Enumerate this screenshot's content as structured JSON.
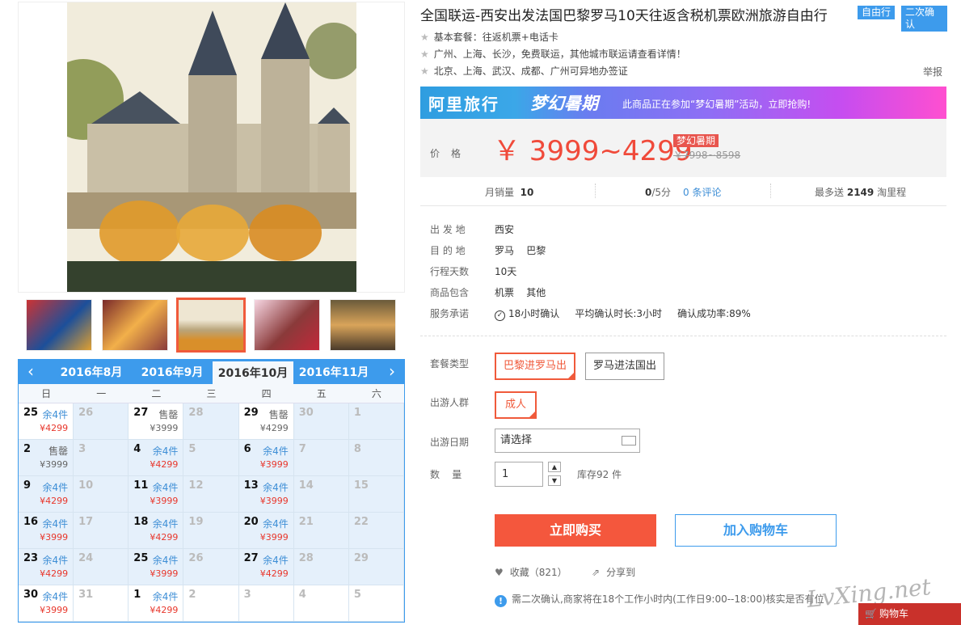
{
  "product": {
    "title": "全国联运-西安出发法国巴黎罗马10天往返含税机票欧洲旅游自由行",
    "tags": [
      "自由行",
      "二次确认"
    ],
    "features": [
      "基本套餐：往返机票+电话卡",
      "广州、上海、长沙，免费联运，其他城市联运请查看详情！",
      "北京、上海、武汉、成都、广州可异地办签证"
    ],
    "report": "举报"
  },
  "banner": {
    "brand": "阿里旅行",
    "campaign": "梦幻暑期",
    "message": "此商品正在参加“梦幻暑期”活动，立即抢购!"
  },
  "price": {
    "label": "价格",
    "value": "￥ 3999~4299",
    "badge": "梦幻暑期",
    "original": "￥7998~8598"
  },
  "stats": {
    "sales_label": "月销量",
    "sales": "10",
    "rating": "0",
    "rating_suffix": "/5分",
    "reviews": "0 条评论",
    "points_prefix": "最多送",
    "points": "2149",
    "points_suffix": "淘里程"
  },
  "details": [
    {
      "label": "出 发 地",
      "value": "西安"
    },
    {
      "label": "目 的 地",
      "value": "罗马    巴黎"
    },
    {
      "label": "行程天数",
      "value": "10天"
    },
    {
      "label": "商品包含",
      "value": "机票    其他"
    },
    {
      "label": "服务承诺",
      "value": "18小时确认     平均确认时长:3小时     确认成功率:89%"
    }
  ],
  "options": {
    "package_label": "套餐类型",
    "packages": [
      "巴黎进罗马出",
      "罗马进法国出"
    ],
    "group_label": "出游人群",
    "groups": [
      "成人"
    ],
    "date_label": "出游日期",
    "date_placeholder": "请选择",
    "qty_label": "数    量",
    "qty": "1",
    "stock": "库存92 件"
  },
  "actions": {
    "buy": "立即购买",
    "cart": "加入购物车",
    "favorite": "收藏（821）",
    "share": "分享到"
  },
  "note": "需二次确认,商家将在18个工作小时内(工作日9:00--18:00)核实是否有位",
  "watermark": "LvXing.net",
  "float_cart": "购物车",
  "calendar": {
    "months": [
      "2016年8月",
      "2016年9月",
      "2016年10月",
      "2016年11月"
    ],
    "active_month": "2016年10月",
    "weekdays": [
      "日",
      "一",
      "二",
      "三",
      "四",
      "五",
      "六"
    ],
    "cells": [
      {
        "d": "25",
        "s": "余4件",
        "p": "¥4299",
        "on": true
      },
      {
        "d": "26",
        "g": true
      },
      {
        "d": "27",
        "s": "售罄",
        "p": "¥3999",
        "on": true,
        "sold": true
      },
      {
        "d": "28",
        "g": true
      },
      {
        "d": "29",
        "s": "售罄",
        "p": "¥4299",
        "on": true,
        "sold": true
      },
      {
        "d": "30",
        "g": true
      },
      {
        "d": "1",
        "g": true
      },
      {
        "d": "2",
        "s": "售罄",
        "p": "¥3999",
        "sold": true
      },
      {
        "d": "3",
        "g": true
      },
      {
        "d": "4",
        "s": "余4件",
        "p": "¥4299"
      },
      {
        "d": "5",
        "g": true
      },
      {
        "d": "6",
        "s": "余4件",
        "p": "¥3999"
      },
      {
        "d": "7",
        "g": true
      },
      {
        "d": "8",
        "g": true
      },
      {
        "d": "9",
        "s": "余4件",
        "p": "¥4299"
      },
      {
        "d": "10",
        "g": true
      },
      {
        "d": "11",
        "s": "余4件",
        "p": "¥3999"
      },
      {
        "d": "12",
        "g": true
      },
      {
        "d": "13",
        "s": "余4件",
        "p": "¥3999"
      },
      {
        "d": "14",
        "g": true
      },
      {
        "d": "15",
        "g": true
      },
      {
        "d": "16",
        "s": "余4件",
        "p": "¥3999"
      },
      {
        "d": "17",
        "g": true
      },
      {
        "d": "18",
        "s": "余4件",
        "p": "¥4299"
      },
      {
        "d": "19",
        "g": true
      },
      {
        "d": "20",
        "s": "余4件",
        "p": "¥3999"
      },
      {
        "d": "21",
        "g": true
      },
      {
        "d": "22",
        "g": true
      },
      {
        "d": "23",
        "s": "余4件",
        "p": "¥4299"
      },
      {
        "d": "24",
        "g": true
      },
      {
        "d": "25",
        "s": "余4件",
        "p": "¥3999"
      },
      {
        "d": "26",
        "g": true
      },
      {
        "d": "27",
        "s": "余4件",
        "p": "¥4299"
      },
      {
        "d": "28",
        "g": true
      },
      {
        "d": "29",
        "g": true
      },
      {
        "d": "30",
        "s": "余4件",
        "p": "¥3999",
        "on": true
      },
      {
        "d": "31",
        "g": true,
        "on": true
      },
      {
        "d": "1",
        "s": "余4件",
        "p": "¥4299",
        "on": true
      },
      {
        "d": "2",
        "g": true,
        "on": true
      },
      {
        "d": "3",
        "g": true,
        "on": true
      },
      {
        "d": "4",
        "g": true,
        "on": true
      },
      {
        "d": "5",
        "g": true,
        "on": true
      }
    ]
  },
  "colors": {
    "accent": "#3d9bec",
    "price": "#f04a3a",
    "buy": "#f4573d"
  }
}
